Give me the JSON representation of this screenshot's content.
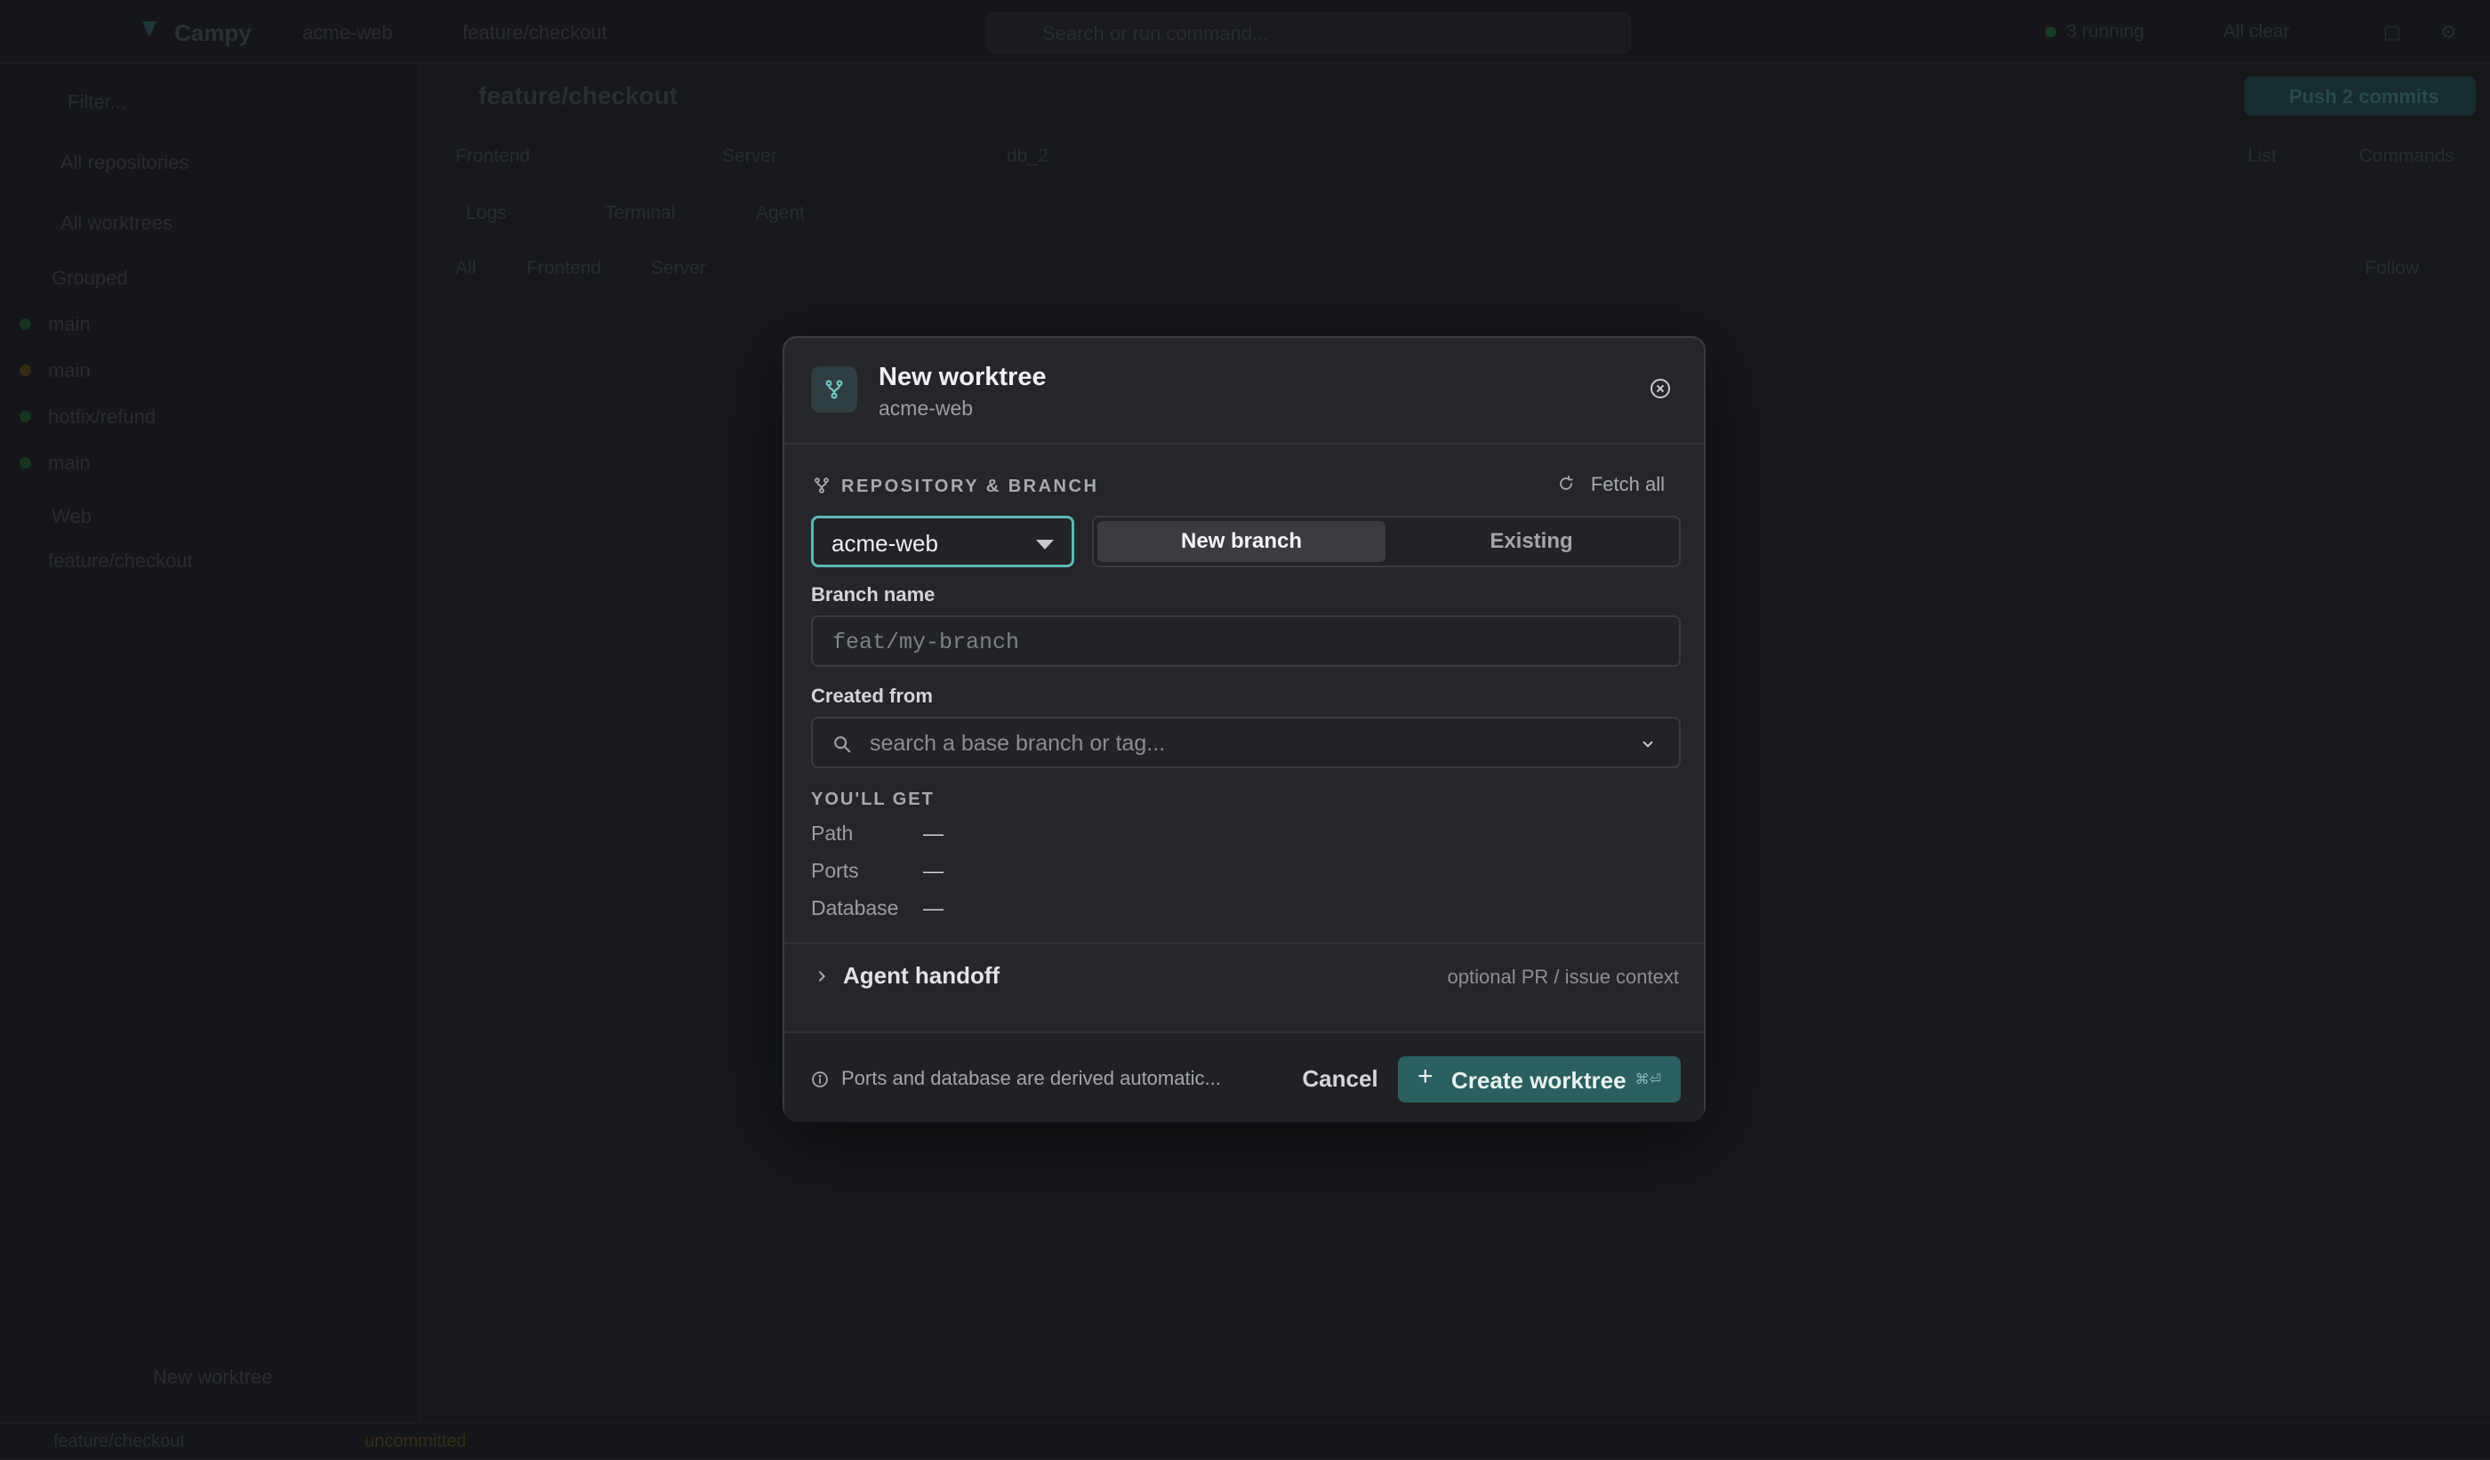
{
  "app": {
    "name": "Campy",
    "crumb_repo": "acme-web",
    "crumb_branch": "feature/checkout",
    "search_placeholder": "Search or run command...",
    "running_label": "3 running",
    "all_clear": "All clear"
  },
  "sidebar": {
    "filter_placeholder": "Filter...",
    "all_repositories": "All repositories",
    "all_worktrees": "All worktrees",
    "group1": "Grouped",
    "items": [
      {
        "label": "main",
        "color": "#2f7a46"
      },
      {
        "label": "main",
        "color": "#8a6a2a"
      },
      {
        "label": "hotfix/refund",
        "color": "#2f7a46"
      },
      {
        "label": "main",
        "color": "#2f7a46"
      }
    ],
    "group2": "Web",
    "active_item": "feature/checkout",
    "new_worktree": "New worktree"
  },
  "main": {
    "title": "feature/checkout",
    "push_label": "Push 2 commits",
    "tabs": [
      "Frontend",
      "Server",
      "db_2"
    ],
    "subtabs": [
      "Logs",
      "Terminal",
      "Agent"
    ],
    "filters": [
      "All",
      "Frontend",
      "Server"
    ],
    "list_label": "List",
    "commands_label": "Commands",
    "follow_label": "Follow"
  },
  "statusbar": {
    "branch": "feature/checkout",
    "state": "uncommitted"
  },
  "modal": {
    "title": "New worktree",
    "subtitle": "acme-web",
    "section_label": "REPOSITORY & BRANCH",
    "fetch_all": "Fetch all",
    "repo_selected": "acme-web",
    "mode_new": "New branch",
    "mode_existing": "Existing",
    "branch_label": "Branch name",
    "branch_placeholder": "feat/my-branch",
    "branch_value": "",
    "created_from_label": "Created from",
    "created_from_placeholder": "search a base branch or tag...",
    "youll_get_label": "YOU'LL GET",
    "rows": [
      {
        "key": "Path",
        "value": "—"
      },
      {
        "key": "Ports",
        "value": "—"
      },
      {
        "key": "Database",
        "value": "—"
      }
    ],
    "handoff_label": "Agent handoff",
    "handoff_hint": "optional PR / issue context",
    "footer_note": "Ports and database are derived automatic...",
    "cancel": "Cancel",
    "create": "Create worktree",
    "create_shortcut": "⌘⏎"
  },
  "colors": {
    "accent": "#5fb8b5",
    "primary_button": "#2b5f60"
  }
}
